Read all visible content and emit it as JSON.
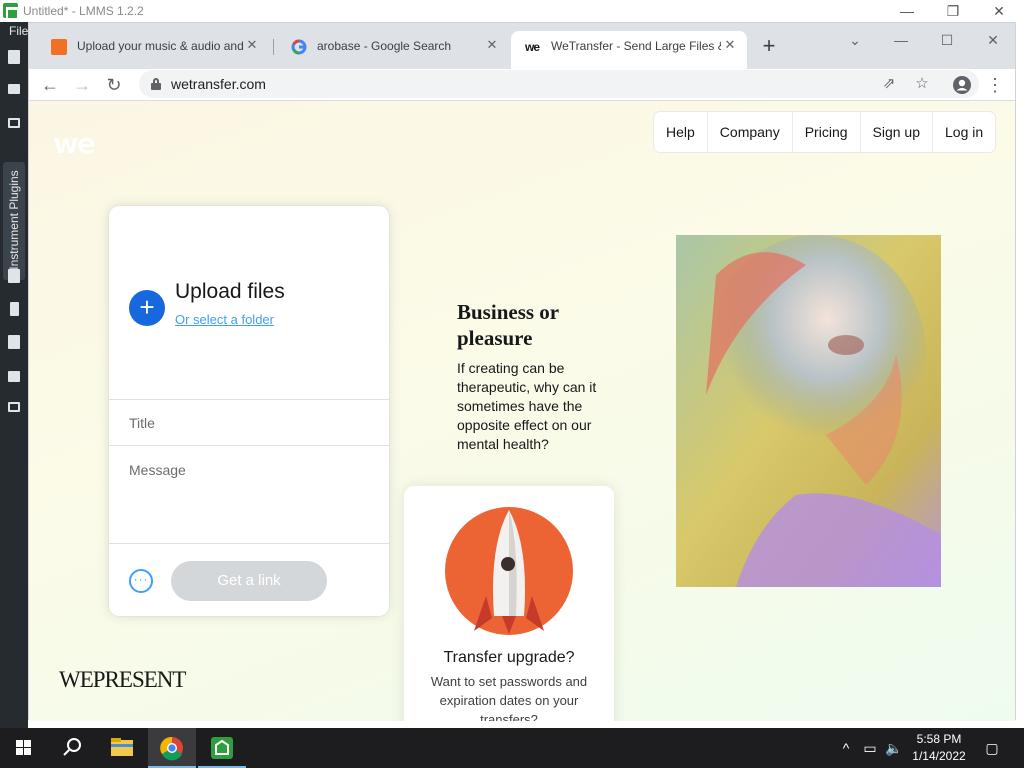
{
  "lmms": {
    "title": "Untitled* - LMMS 1.2.2",
    "menu_file": "File",
    "plugins_tab": "Instrument Plugins",
    "controls": {
      "minimize": "—",
      "restore": "❐",
      "close": "✕"
    }
  },
  "browser": {
    "tabs": [
      {
        "label": "Upload your music & audio and",
        "icon": "soundcloud-icon"
      },
      {
        "label": "arobase - Google Search",
        "icon": "google-icon"
      },
      {
        "label": "WeTransfer - Send Large Files &",
        "icon": "wetransfer-icon"
      }
    ],
    "url": "wetransfer.com",
    "controls": {
      "tab_search": "⌄",
      "minimize": "—",
      "maximize": "☐",
      "close": "✕"
    }
  },
  "page": {
    "logo": "we",
    "nav": [
      "Help",
      "Company",
      "Pricing",
      "Sign up",
      "Log in"
    ],
    "upload": {
      "heading": "Upload files",
      "select_folder": "Or select a folder",
      "title_placeholder": "Title",
      "message_placeholder": "Message",
      "get_link": "Get a link"
    },
    "wepresent": {
      "heading": "Business or pleasure",
      "body": "If creating can be therapeutic, why can it sometimes have the opposite effect on our mental health?",
      "logo": "WEPRESENT"
    },
    "transfer_card": {
      "title": "Transfer upgrade?",
      "body": "Want to set passwords and expiration dates on your transfers?"
    }
  },
  "taskbar": {
    "time": "5:58 PM",
    "date": "1/14/2022"
  },
  "colors": {
    "accent_blue": "#1767df",
    "link_blue": "#409fff",
    "rocket_orange": "#ec6434"
  }
}
